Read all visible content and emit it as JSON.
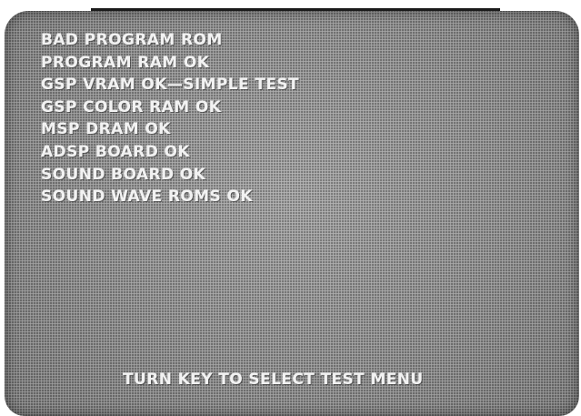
{
  "screen": {
    "status_lines": [
      "BAD PROGRAM ROM",
      "PROGRAM RAM OK",
      "GSP VRAM OK—SIMPLE TEST",
      "GSP COLOR RAM OK",
      "MSP DRAM OK",
      "ADSP BOARD OK",
      "SOUND BOARD OK",
      "SOUND WAVE ROMS OK"
    ],
    "prompt": "TURN KEY TO SELECT TEST MENU"
  }
}
